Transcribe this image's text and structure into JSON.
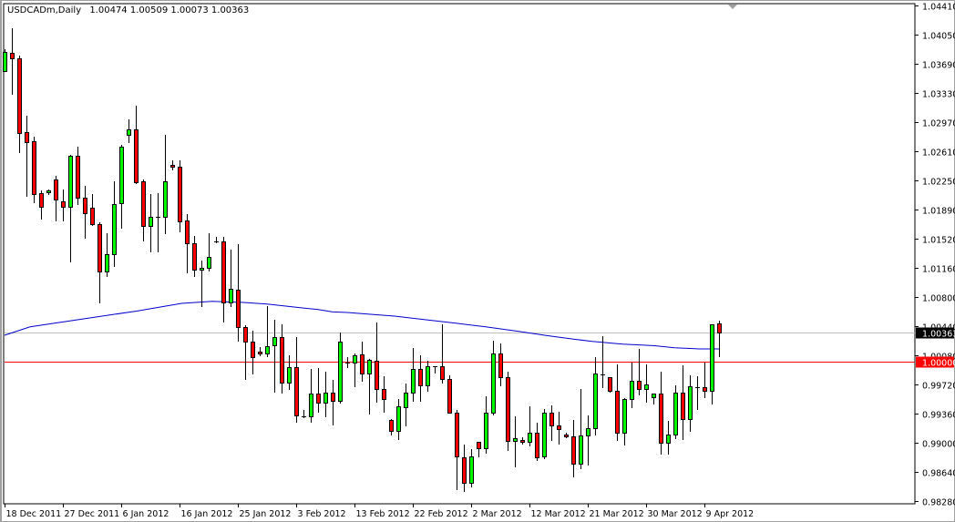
{
  "header": {
    "title": "USDCADm,Daily",
    "values": "1.00474 1.00509 1.00073 1.00363"
  },
  "colors": {
    "bull": "#00ff00",
    "bear": "#ff0000",
    "outline": "#000000",
    "ma_line": "#0000cc",
    "bid_line": "#c0c0c0",
    "level_line": "#ff0000"
  },
  "chart_data": {
    "type": "candlestick",
    "title": "USDCADm,Daily",
    "symbol": "USDCADm",
    "timeframe": "Daily",
    "ylim": [
      0.9828,
      1.0441
    ],
    "y_ticks": [
      "1.04410",
      "1.04050",
      "1.03690",
      "1.03330",
      "1.02970",
      "1.02610",
      "1.02250",
      "1.01890",
      "1.01520",
      "1.01160",
      "1.00800",
      "1.00440",
      "1.00080",
      "0.99720",
      "0.99360",
      "0.99000",
      "0.98640",
      "0.98280"
    ],
    "x_ticks": [
      {
        "index": 0,
        "label": "18 Dec 2011"
      },
      {
        "index": 8,
        "label": "27 Dec 2011"
      },
      {
        "index": 16,
        "label": "6 Jan 2012"
      },
      {
        "index": 24,
        "label": "16 Jan 2012"
      },
      {
        "index": 32,
        "label": "25 Jan 2012"
      },
      {
        "index": 40,
        "label": "3 Feb 2012"
      },
      {
        "index": 48,
        "label": "13 Feb 2012"
      },
      {
        "index": 56,
        "label": "22 Feb 2012"
      },
      {
        "index": 64,
        "label": "2 Mar 2012"
      },
      {
        "index": 72,
        "label": "12 Mar 2012"
      },
      {
        "index": 80,
        "label": "21 Mar 2012"
      },
      {
        "index": 88,
        "label": "30 Mar 2012"
      },
      {
        "index": 96,
        "label": "9 Apr 2012"
      }
    ],
    "ohlc_fields": [
      "open",
      "high",
      "low",
      "close"
    ],
    "candles": [
      [
        1.03596,
        1.0387,
        1.03596,
        1.03832
      ],
      [
        1.03821,
        1.04128,
        1.03314,
        1.03754
      ],
      [
        1.03754,
        1.03787,
        1.026,
        1.02837
      ],
      [
        1.02841,
        1.03048,
        1.0206,
        1.02724
      ],
      [
        1.02729,
        1.02789,
        1.01981,
        1.02083
      ],
      [
        1.02087,
        1.02124,
        1.01775,
        1.01918
      ],
      [
        1.02098,
        1.02135,
        1.02083,
        1.02121
      ],
      [
        1.02256,
        1.02304,
        1.01756,
        1.02008
      ],
      [
        1.01986,
        1.02135,
        1.01756,
        1.01918
      ],
      [
        1.01918,
        1.02564,
        1.01238,
        1.02549
      ],
      [
        1.02549,
        1.02665,
        1.01948,
        1.02031
      ],
      [
        1.02031,
        1.0218,
        1.01542,
        1.01839
      ],
      [
        1.01907,
        1.02079,
        1.01689,
        1.01704
      ],
      [
        1.01704,
        1.01727,
        1.00731,
        1.01119
      ],
      [
        1.01119,
        1.01595,
        1.01058,
        1.01332
      ],
      [
        1.01332,
        1.02237,
        1.01182,
        1.01952
      ],
      [
        1.01963,
        1.02684,
        1.01666,
        1.02661
      ],
      [
        1.02808,
        1.03002,
        1.02724,
        1.02875
      ],
      [
        1.02875,
        1.03171,
        1.02218,
        1.02229
      ],
      [
        1.02233,
        1.02259,
        1.01508,
        1.01688
      ],
      [
        1.01688,
        1.02083,
        1.01362,
        1.01794
      ],
      [
        1.01794,
        1.0209,
        1.0137,
        1.01794
      ],
      [
        1.01794,
        1.02811,
        1.01598,
        1.02233
      ],
      [
        1.02436,
        1.02496,
        1.02387,
        1.02414
      ],
      [
        1.02414,
        1.02496,
        1.01621,
        1.01738
      ],
      [
        1.01749,
        1.0183,
        1.01108,
        1.01468
      ],
      [
        1.01468,
        1.0156,
        1.01062,
        1.01145
      ],
      [
        1.01145,
        1.01257,
        1.00686,
        1.01164
      ],
      [
        1.01164,
        1.01595,
        1.0113,
        1.01299
      ],
      [
        1.01497,
        1.0155,
        1.01475,
        1.01497
      ],
      [
        1.0149,
        1.0155,
        1.00499,
        1.00739
      ],
      [
        1.00739,
        1.01392,
        1.00686,
        1.00905
      ],
      [
        1.00893,
        1.01456,
        1.00258,
        1.00432
      ],
      [
        1.00432,
        1.00454,
        0.99786,
        1.00252
      ],
      [
        1.00252,
        1.00387,
        0.99853,
        1.0006
      ],
      [
        1.00131,
        1.00188,
        1.00078,
        1.00105
      ],
      [
        1.00105,
        1.00686,
        1.00067,
        1.00195
      ],
      [
        1.00207,
        1.00525,
        0.99628,
        1.00308
      ],
      [
        1.00308,
        1.00469,
        0.99617,
        0.99745
      ],
      [
        0.99745,
        1.00082,
        0.99663,
        0.99936
      ],
      [
        0.99936,
        1.0031,
        0.99261,
        0.9934
      ],
      [
        0.99332,
        0.9941,
        0.99317,
        0.99332
      ],
      [
        0.99328,
        0.99917,
        0.99261,
        0.9961
      ],
      [
        0.9961,
        0.99928,
        0.9938,
        0.99501
      ],
      [
        0.99501,
        0.9988,
        0.99324,
        0.99621
      ],
      [
        0.99621,
        0.99782,
        0.99227,
        0.9952
      ],
      [
        0.9952,
        1.00365,
        0.99497,
        1.00252
      ],
      [
        0.99996,
        1.00066,
        0.99936,
        0.99996
      ],
      [
        0.99996,
        1.00109,
        0.997,
        1.00082
      ],
      [
        1.00094,
        1.00251,
        0.99767,
        0.99861
      ],
      [
        0.99861,
        1.00041,
        0.99362,
        1.00026
      ],
      [
        1.00015,
        1.00491,
        0.99504,
        0.99666
      ],
      [
        0.99666,
        0.99824,
        0.9938,
        0.99542
      ],
      [
        0.99283,
        0.99298,
        0.99103,
        0.99148
      ],
      [
        0.99148,
        0.99542,
        0.99043,
        0.99452
      ],
      [
        0.9944,
        0.99737,
        0.99211,
        0.99621
      ],
      [
        0.99621,
        1.00176,
        0.99515,
        0.99914
      ],
      [
        0.99914,
        1.00086,
        0.99515,
        0.99711
      ],
      [
        0.99711,
        1.00019,
        0.9964,
        0.99948
      ],
      [
        0.99944,
        0.99951,
        0.99865,
        0.99944
      ],
      [
        0.99948,
        1.00469,
        0.99745,
        0.9979
      ],
      [
        0.9979,
        0.99838,
        0.99373,
        0.99373
      ],
      [
        0.99373,
        0.9941,
        0.98428,
        0.98828
      ],
      [
        0.98822,
        0.98983,
        0.98405,
        0.98506
      ],
      [
        0.98506,
        0.98923,
        0.98461,
        0.98833
      ],
      [
        0.99013,
        0.99013,
        0.98833,
        0.98934
      ],
      [
        0.98934,
        0.9958,
        0.98878,
        0.99373
      ],
      [
        0.99373,
        1.00266,
        0.99351,
        1.00105
      ],
      [
        1.00105,
        1.00229,
        0.99711,
        0.99813
      ],
      [
        0.99813,
        0.9988,
        0.98912,
        0.99024
      ],
      [
        0.99024,
        0.99332,
        0.98709,
        0.99058
      ],
      [
        0.99035,
        0.99069,
        0.9899,
        0.99008
      ],
      [
        0.99013,
        0.99456,
        0.98963,
        0.99126
      ],
      [
        0.99126,
        0.99253,
        0.98788,
        0.98822
      ],
      [
        0.98828,
        0.99422,
        0.98811,
        0.99373
      ],
      [
        0.99373,
        0.99467,
        0.99035,
        0.99216
      ],
      [
        0.99216,
        0.99388,
        0.98986,
        0.99171
      ],
      [
        0.99107,
        0.9912,
        0.9907,
        0.99081
      ],
      [
        0.99081,
        0.99287,
        0.98585,
        0.98743
      ],
      [
        0.98743,
        0.99669,
        0.98686,
        0.99092
      ],
      [
        0.99092,
        0.99343,
        0.98727,
        0.99182
      ],
      [
        0.99182,
        1.00064,
        0.99099,
        0.99858
      ],
      [
        0.9985,
        1.00323,
        0.99684,
        0.9985
      ],
      [
        0.99813,
        0.99813,
        0.99628,
        0.9964
      ],
      [
        0.99643,
        0.99974,
        0.99031,
        0.99126
      ],
      [
        0.99126,
        0.99557,
        0.98975,
        0.99542
      ],
      [
        0.99542,
        0.99989,
        0.99437,
        0.99767
      ],
      [
        0.99767,
        1.00165,
        0.99594,
        0.99666
      ],
      [
        0.99666,
        0.99974,
        0.99504,
        0.99722
      ],
      [
        0.99569,
        0.9961,
        0.99482,
        0.9961
      ],
      [
        0.9961,
        0.99883,
        0.98862,
        0.99002
      ],
      [
        0.99002,
        0.99276,
        0.98862,
        0.99103
      ],
      [
        0.99103,
        0.99715,
        0.99054,
        0.99621
      ],
      [
        0.99621,
        0.99962,
        0.99043,
        0.99295
      ],
      [
        0.99295,
        0.99838,
        0.99148,
        0.997
      ],
      [
        0.99689,
        0.99827,
        0.99418,
        0.99689
      ],
      [
        0.99689,
        0.99996,
        0.99569,
        0.99643
      ],
      [
        0.99643,
        1.00466,
        0.99486,
        1.00466
      ],
      [
        1.00474,
        1.00509,
        1.00073,
        1.00363
      ]
    ],
    "moving_average": {
      "points": [
        [
          0,
          1.00331
        ],
        [
          3.5,
          1.00435
        ],
        [
          11.9,
          1.00548
        ],
        [
          18.1,
          1.0063
        ],
        [
          24.3,
          1.00725
        ],
        [
          28.5,
          1.0075
        ],
        [
          32.8,
          1.00736
        ],
        [
          36,
          1.00717
        ],
        [
          39,
          1.00687
        ],
        [
          41,
          1.00668
        ],
        [
          43,
          1.00649
        ],
        [
          45,
          1.00619
        ],
        [
          47,
          1.00612
        ],
        [
          49.4,
          1.00596
        ],
        [
          53.5,
          1.00567
        ],
        [
          57.8,
          1.00522
        ],
        [
          61.9,
          1.0048
        ],
        [
          66,
          1.00435
        ],
        [
          70.3,
          1.00382
        ],
        [
          74.4,
          1.00326
        ],
        [
          78.5,
          1.00278
        ],
        [
          80.6,
          1.00255
        ],
        [
          84.8,
          1.00221
        ],
        [
          89,
          1.00202
        ],
        [
          91.9,
          1.00176
        ],
        [
          95.3,
          1.00162
        ],
        [
          98,
          1.00162
        ]
      ]
    },
    "bid_price": "1.00363",
    "horizontal_level": "1.00000"
  }
}
